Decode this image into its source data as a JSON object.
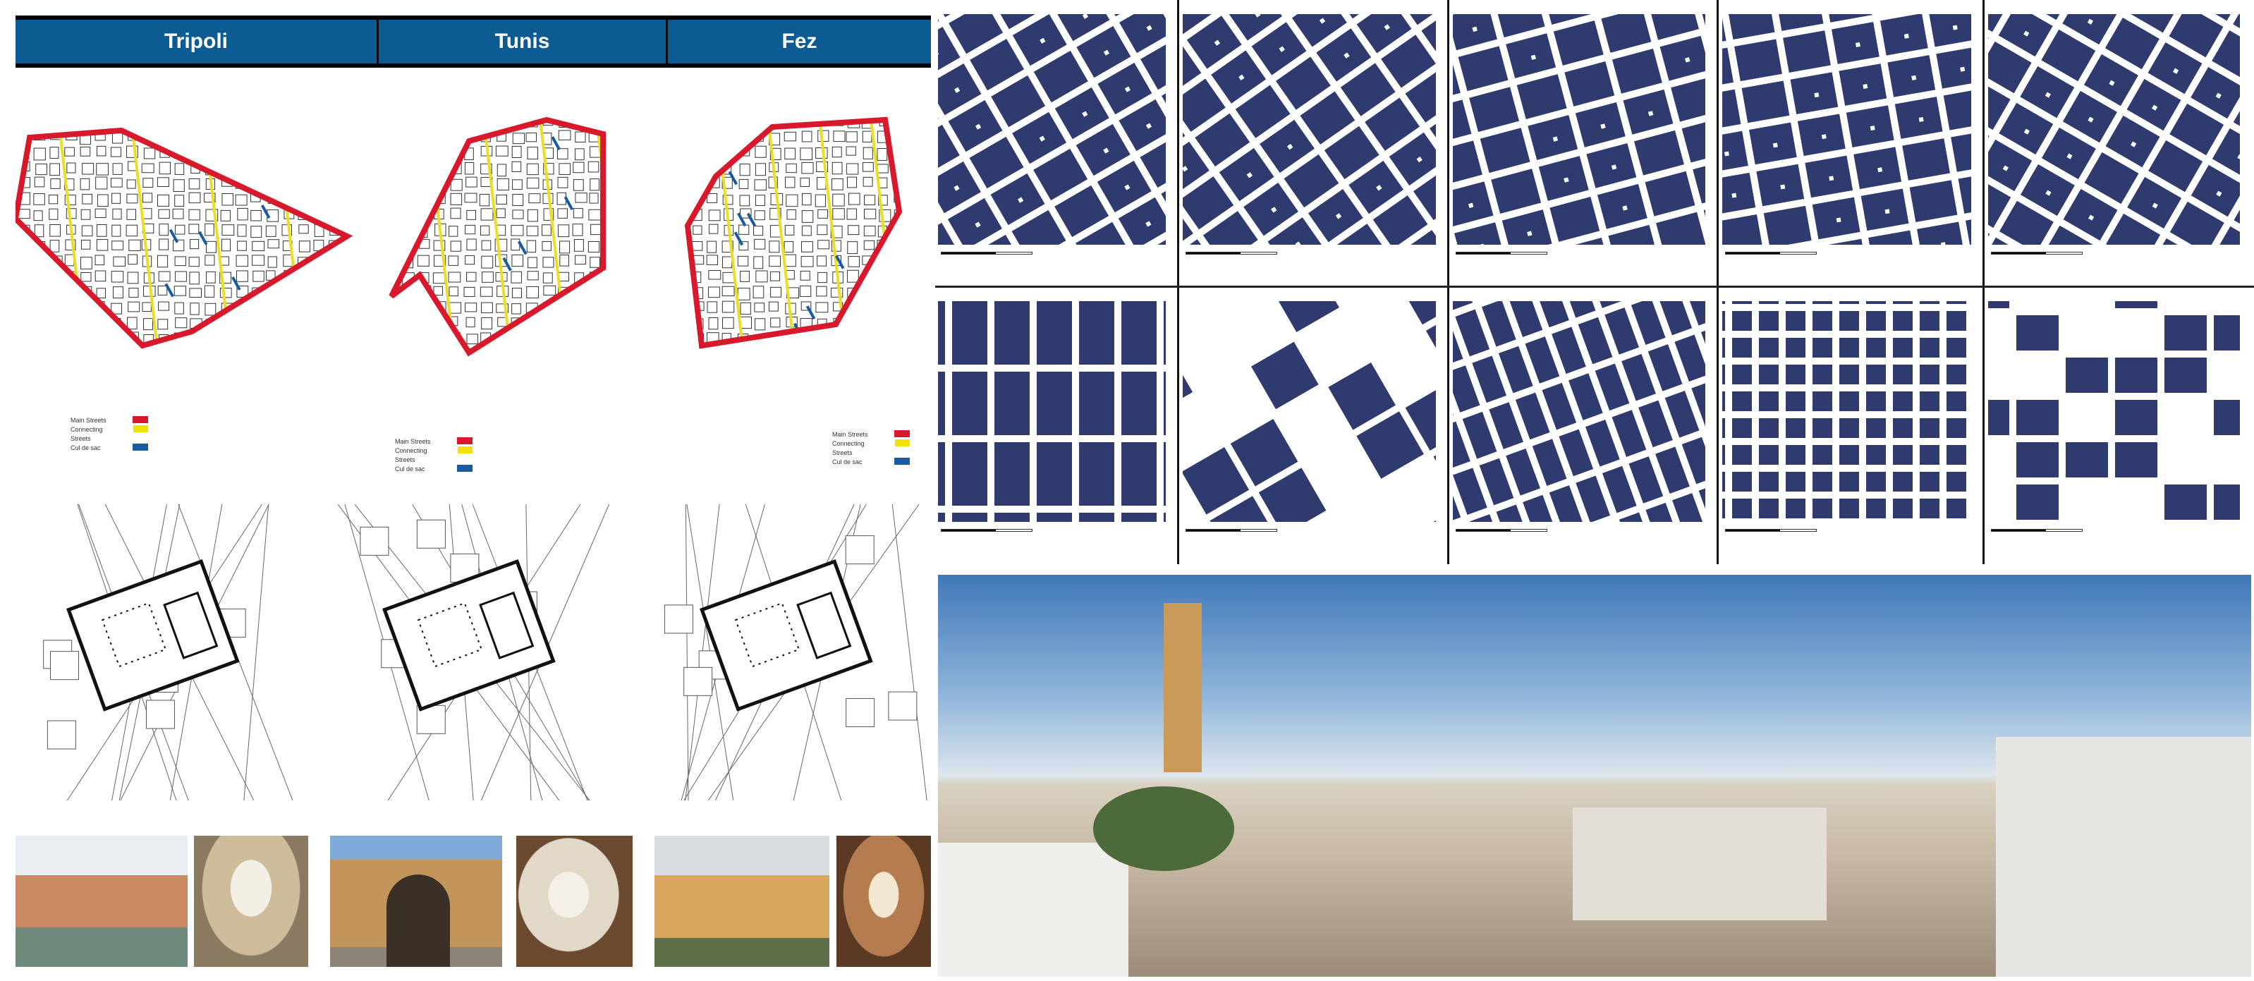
{
  "header": {
    "columns": [
      "Tripoli",
      "Tunis",
      "Fez"
    ]
  },
  "legend": {
    "items": [
      {
        "label": "Main Streets",
        "color": "#d7192b"
      },
      {
        "label": "Connecting Streets",
        "color": "#f2e200"
      },
      {
        "label": "Cul de sac",
        "color": "#1a5aa0"
      }
    ]
  },
  "colors": {
    "figure": "#2f3a6f",
    "street_main": "#d7192b",
    "street_connect": "#e9df2a",
    "culdesac": "#1a5aa0",
    "header": "#0d5b93"
  }
}
